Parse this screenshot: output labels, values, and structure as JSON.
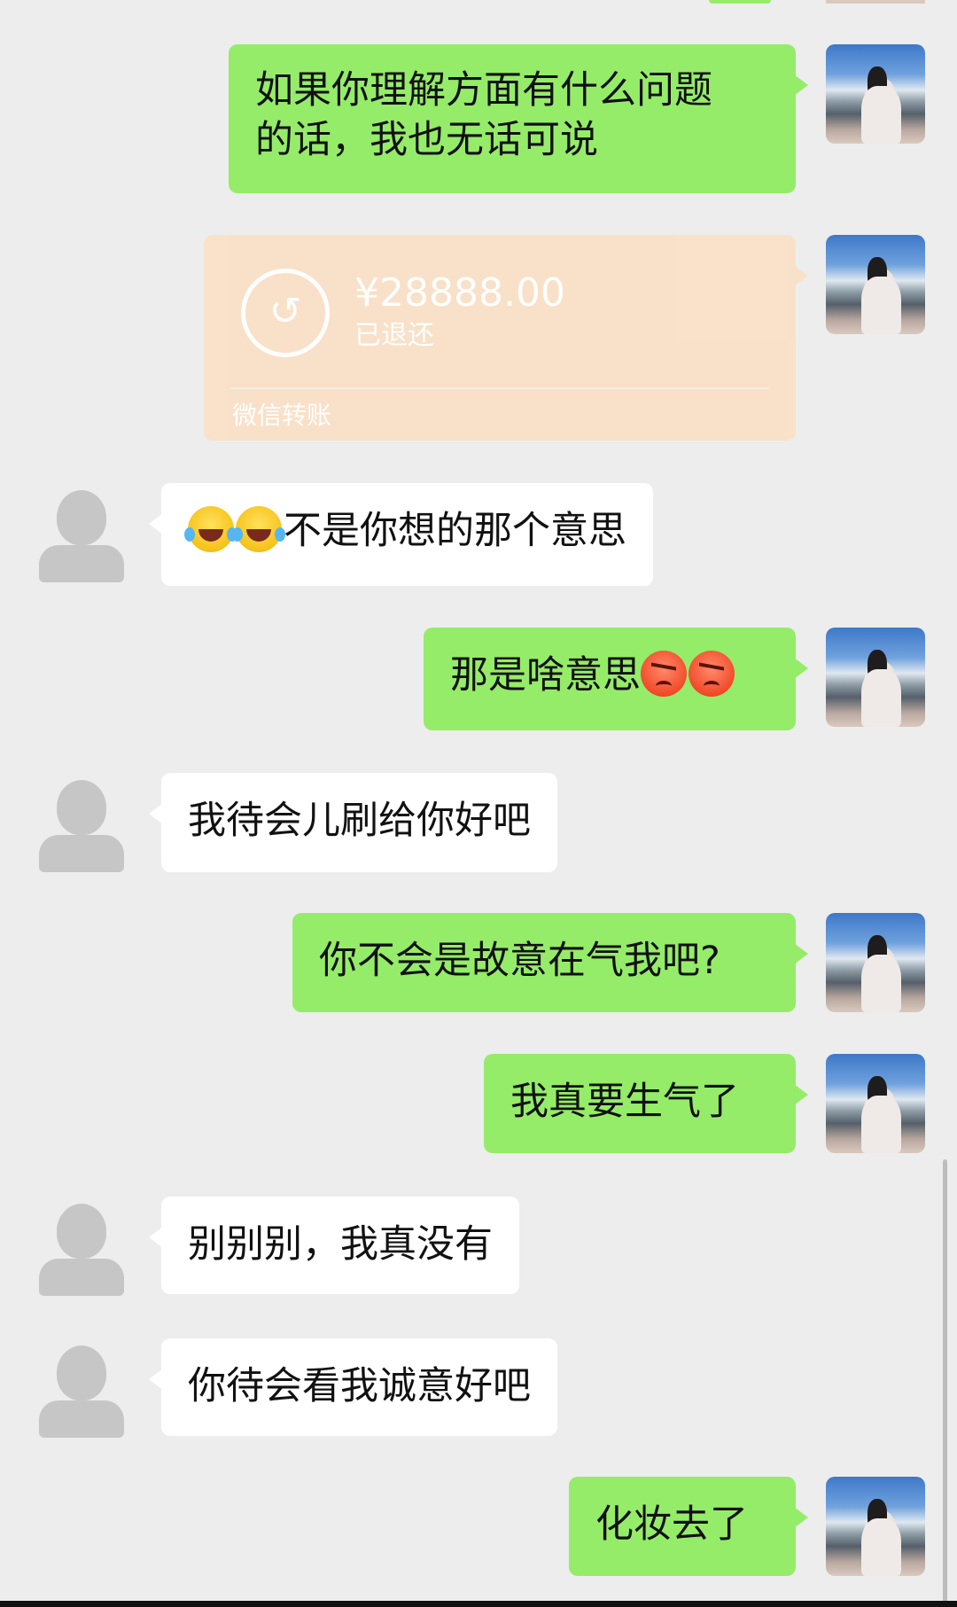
{
  "messages": [
    {
      "from": "me",
      "lines": [
        "如果你理解方面有什么问题",
        "的话，我也无话可说"
      ]
    },
    {
      "from": "me",
      "type": "transfer",
      "amount": "¥28888.00",
      "status": "已退还",
      "source": "微信转账",
      "icon": "return-arrow-icon"
    },
    {
      "from": "other",
      "emoji": "laughing-tears-icon",
      "text": "不是你想的那个意思"
    },
    {
      "from": "me",
      "text": "那是啥意思",
      "emoji": "angry-face-icon"
    },
    {
      "from": "other",
      "text": "我待会儿刷给你好吧"
    },
    {
      "from": "me",
      "text": "你不会是故意在气我吧?"
    },
    {
      "from": "me",
      "text": "我真要生气了"
    },
    {
      "from": "other",
      "text": "别别别，我真没有"
    },
    {
      "from": "other",
      "text": "你待会看我诚意好吧"
    },
    {
      "from": "me",
      "text": "化妆去了"
    }
  ],
  "colors": {
    "background": "#ededed",
    "my_bubble": "#95ec69",
    "their_bubble": "#ffffff",
    "transfer_card": "#f9e1c8"
  }
}
